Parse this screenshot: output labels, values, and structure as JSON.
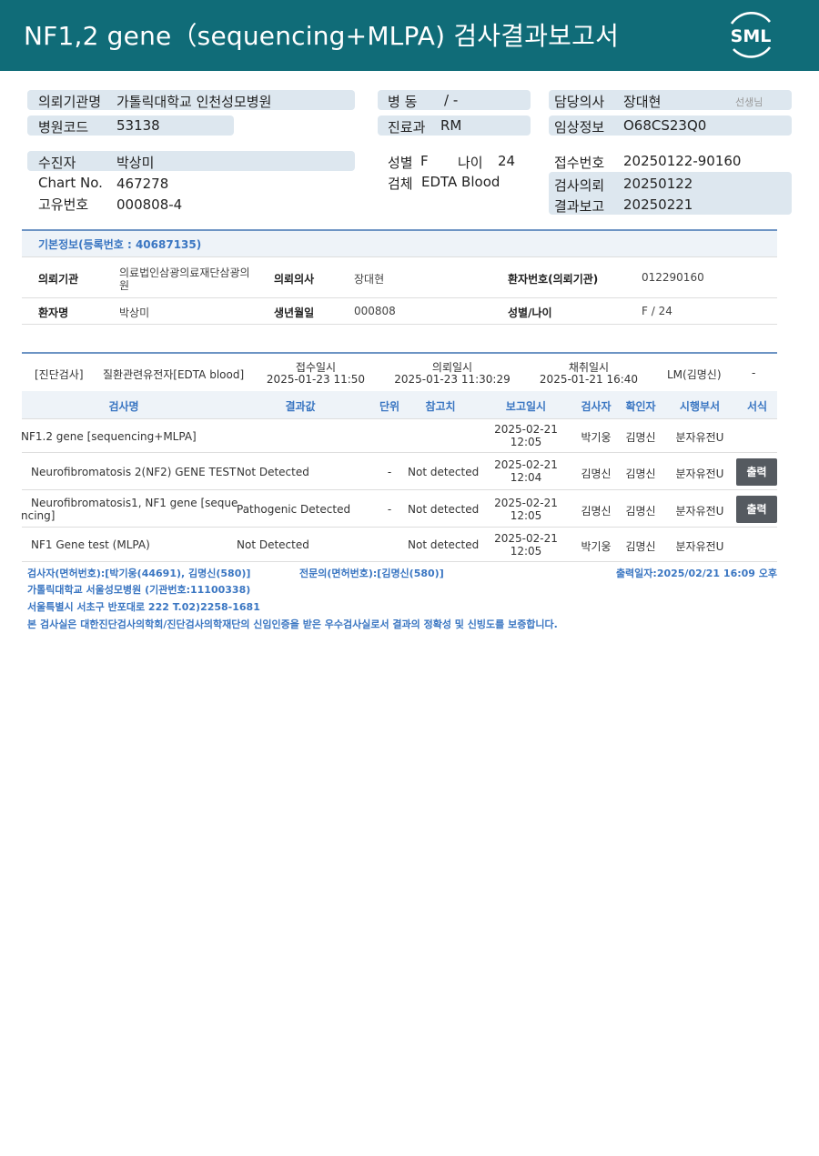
{
  "header": {
    "title": "NF1,2  gene（sequencing+MLPA) 검사결과보고서",
    "logo_text": "SML"
  },
  "top": {
    "institution_label": "의뢰기관명",
    "institution": "가톨릭대학교 인천성모병원",
    "hospital_code_label": "병원코드",
    "hospital_code": "53138",
    "ward_label": "병  동",
    "ward": "/ -",
    "department_label": "진료과",
    "department": "RM",
    "doctor_label": "담당의사",
    "doctor": "장대현",
    "doctor_suffix": "선생님",
    "clinical_label": "임상정보",
    "clinical": "O68CS23Q0",
    "patient_label": "수진자",
    "patient": "박상미",
    "chart_label": "Chart No.",
    "chart": "467278",
    "unique_label": "고유번호",
    "unique": "000808-4",
    "sex_label": "성별",
    "sex": "F",
    "age_label": "나이",
    "age": "24",
    "specimen_label": "검체",
    "specimen": "EDTA Blood",
    "reception_label": "접수번호",
    "reception": "20250122-90160",
    "request_label": "검사의뢰",
    "request": "20250122",
    "report_label": "결과보고",
    "report": "20250221"
  },
  "basic_info": {
    "title": "기본정보(등록번호 : 40687135)",
    "inst_label": "의뢰기관",
    "inst_line1": "의료법인삼광의료재단삼광의",
    "inst_line2": "원",
    "doc_label": "의뢰의사",
    "doc": "장대현",
    "patno_label": "환자번호(의뢰기관)",
    "patno": "012290160",
    "name_label": "환자명",
    "name": "박상미",
    "dob_label": "생년월일",
    "dob": "000808",
    "sexage_label": "성별/나이",
    "sexage": "F / 24"
  },
  "exam": {
    "category": "[진단검사]",
    "type": "질환관련유전자[EDTA blood]",
    "received_label": "접수일시",
    "received": "2025-01-23 11:50",
    "requested_label": "의뢰일시",
    "requested": "2025-01-23 11:30:29",
    "collected_label": "채취일시",
    "collected": "2025-01-21 16:40",
    "lm": "LM(김명신)",
    "dash": "-"
  },
  "table": {
    "headers": [
      "검사명",
      "결과값",
      "단위",
      "참고치",
      "보고일시",
      "검사자",
      "확인자",
      "시행부서",
      "서식"
    ],
    "rows": [
      {
        "name": "NF1.2 gene [sequencing+MLPA]",
        "name2": "",
        "result": "",
        "unit": "",
        "ref": "",
        "date": "2025-02-21",
        "time": "12:05",
        "tester": "박기웅",
        "confirmer": "김명신",
        "dept": "분자유전U",
        "btn": ""
      },
      {
        "name": "Neurofibromatosis 2(NF2) GENE TEST",
        "name2": "",
        "result": "Not Detected",
        "unit": "-",
        "ref": "Not detected",
        "date": "2025-02-21",
        "time": "12:04",
        "tester": "김명신",
        "confirmer": "김명신",
        "dept": "분자유전U",
        "btn": "출력"
      },
      {
        "name": "Neurofibromatosis1, NF1 gene [seque",
        "name2": "ncing]",
        "result": "Pathogenic Detected",
        "unit": "-",
        "ref": "Not detected",
        "date": "2025-02-21",
        "time": "12:05",
        "tester": "김명신",
        "confirmer": "김명신",
        "dept": "분자유전U",
        "btn": "출력"
      },
      {
        "name": "NF1 Gene test (MLPA)",
        "name2": "",
        "result": "Not Detected",
        "unit": "",
        "ref": "Not detected",
        "date": "2025-02-21",
        "time": "12:05",
        "tester": "박기웅",
        "confirmer": "김명신",
        "dept": "분자유전U",
        "btn": ""
      }
    ]
  },
  "footer": {
    "testers": "검사자(면허번호):[박기웅(44691), 김명신(580)]",
    "specialist": "전문의(면허번호):[김명신(580)]",
    "printed": "출력일자:2025/02/21 16:09 오후",
    "hospital": "가톨릭대학교 서울성모병원 (기관번호:11100338)",
    "address": "서울특별시 서초구 반포대로 222 T.02)2258-1681",
    "certification": "본 검사실은 대한진단검사의학회/진단검사의학재단의 신임인증을 받은 우수검사실로서 결과의 정확성 및 신빙도를 보증합니다."
  },
  "colors": {
    "header_bg": "#106c78",
    "label_bg": "#dde7ef",
    "accent_blue": "#3a76c2",
    "button_bg": "#555a60"
  }
}
